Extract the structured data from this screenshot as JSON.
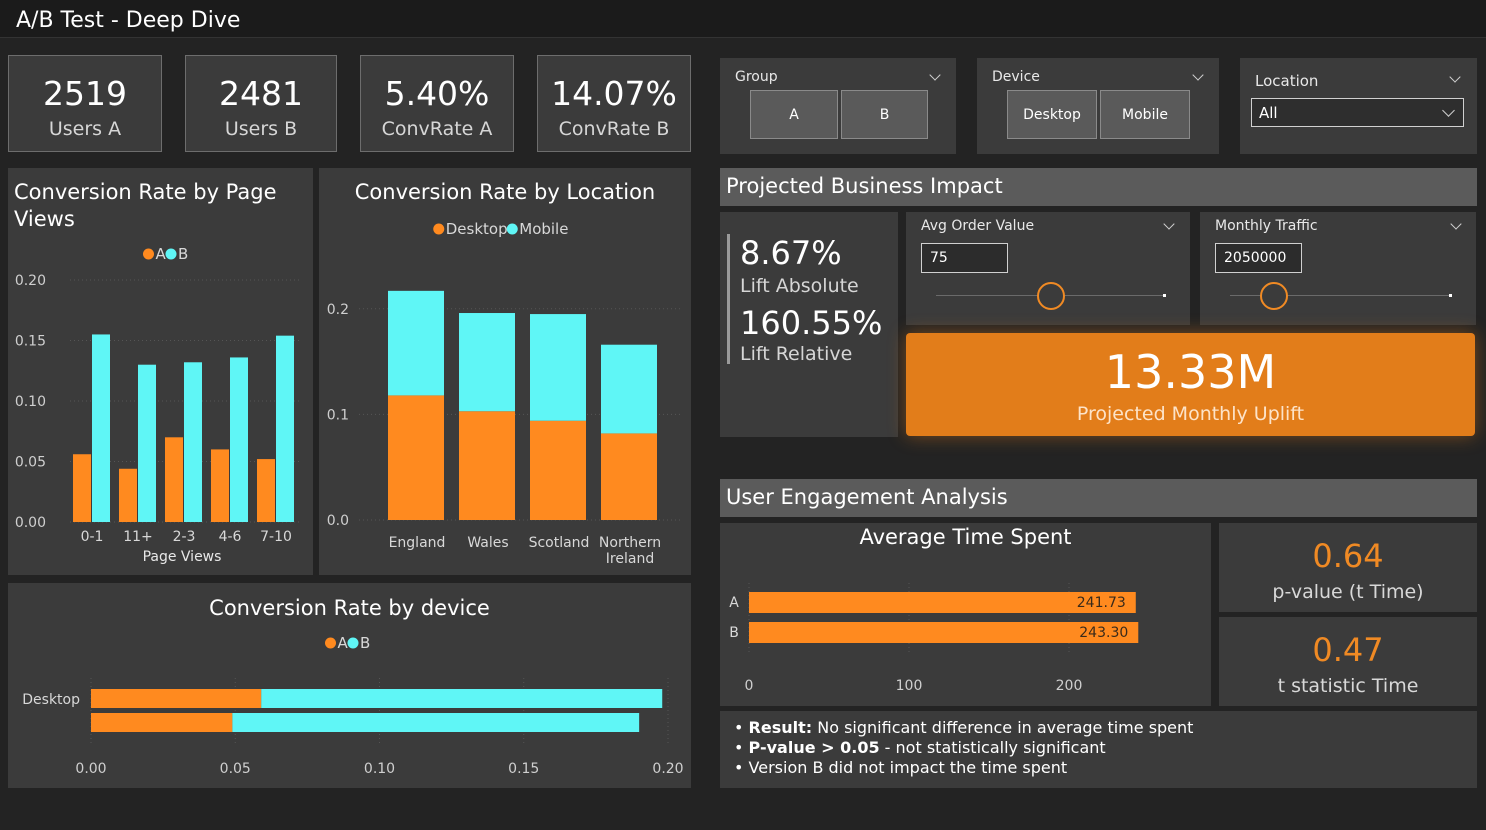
{
  "title": "A/B Test - Deep Dive",
  "kpis": [
    {
      "value": "2519",
      "label": "Users A"
    },
    {
      "value": "2481",
      "label": "Users B"
    },
    {
      "value": "5.40%",
      "label": "ConvRate A"
    },
    {
      "value": "14.07%",
      "label": "ConvRate B"
    }
  ],
  "slicers": {
    "group": {
      "title": "Group",
      "options": [
        "A",
        "B"
      ]
    },
    "device": {
      "title": "Device",
      "options": [
        "Desktop",
        "Mobile"
      ]
    },
    "location": {
      "title": "Location",
      "selected": "All"
    }
  },
  "business": {
    "header": "Projected Business Impact",
    "lift_abs_value": "8.67%",
    "lift_abs_label": "Lift Absolute",
    "lift_rel_value": "160.55%",
    "lift_rel_label": "Lift Relative",
    "aov": {
      "title": "Avg Order Value",
      "value": "75",
      "slider_level": 0.5
    },
    "traffic": {
      "title": "Monthly Traffic",
      "value": "2050000",
      "slider_level": 0.2
    },
    "uplift_value": "13.33M",
    "uplift_label": "Projected Monthly Uplift"
  },
  "engagement": {
    "header": "User Engagement Analysis",
    "pvalue": "0.64",
    "pvalue_label": "p-value (t Time)",
    "tstat": "0.47",
    "tstat_label": "t statistic Time",
    "result_1_bold": "Result:",
    "result_1": " No significant difference in average time spent",
    "result_2_bold": "P-value > 0.05",
    "result_2": " - not statistically significant",
    "result_3": "Version B did not impact the time spent"
  },
  "colors": {
    "orange": "#ff8a1f",
    "cyan": "#5ff6f6",
    "accent": "#e27d1a"
  },
  "chart_data": [
    {
      "type": "bar",
      "title": "Conversion Rate by Page Views",
      "xlabel": "Page Views",
      "ylabel": "",
      "categories": [
        "0-1",
        "11+",
        "2-3",
        "4-6",
        "7-10"
      ],
      "series": [
        {
          "name": "A",
          "values": [
            0.056,
            0.044,
            0.07,
            0.06,
            0.052
          ]
        },
        {
          "name": "B",
          "values": [
            0.155,
            0.13,
            0.132,
            0.136,
            0.154
          ]
        }
      ],
      "ylim": [
        0,
        0.2
      ],
      "yticks": [
        "0.00",
        "0.05",
        "0.10",
        "0.15",
        "0.20"
      ],
      "legend": "top"
    },
    {
      "type": "bar",
      "stacked": true,
      "title": "Conversion Rate by Location",
      "categories": [
        "England",
        "Wales",
        "Scotland",
        "Northern Ireland"
      ],
      "series": [
        {
          "name": "Desktop",
          "values": [
            0.118,
            0.103,
            0.094,
            0.082
          ]
        },
        {
          "name": "Mobile",
          "values": [
            0.099,
            0.093,
            0.101,
            0.084
          ]
        }
      ],
      "ylim": [
        0,
        0.25
      ],
      "yticks": [
        "0.0",
        "0.1",
        "0.2"
      ],
      "legend": "top"
    },
    {
      "type": "bar",
      "orientation": "horizontal",
      "stacked": true,
      "title": "Conversion Rate by device",
      "categories": [
        "Desktop",
        ""
      ],
      "series": [
        {
          "name": "A",
          "values": [
            0.059,
            0.049
          ]
        },
        {
          "name": "B",
          "values": [
            0.139,
            0.141
          ]
        }
      ],
      "xlim": [
        0,
        0.2
      ],
      "xticks": [
        "0.00",
        "0.05",
        "0.10",
        "0.15",
        "0.20"
      ],
      "legend": "top"
    },
    {
      "type": "bar",
      "orientation": "horizontal",
      "title": "Average Time Spent",
      "categories": [
        "A",
        "B"
      ],
      "values": [
        241.73,
        243.3
      ],
      "labels": [
        "241.73",
        "243.30"
      ],
      "xlim": [
        0,
        245
      ],
      "xticks": [
        "0",
        "100",
        "200"
      ]
    }
  ]
}
